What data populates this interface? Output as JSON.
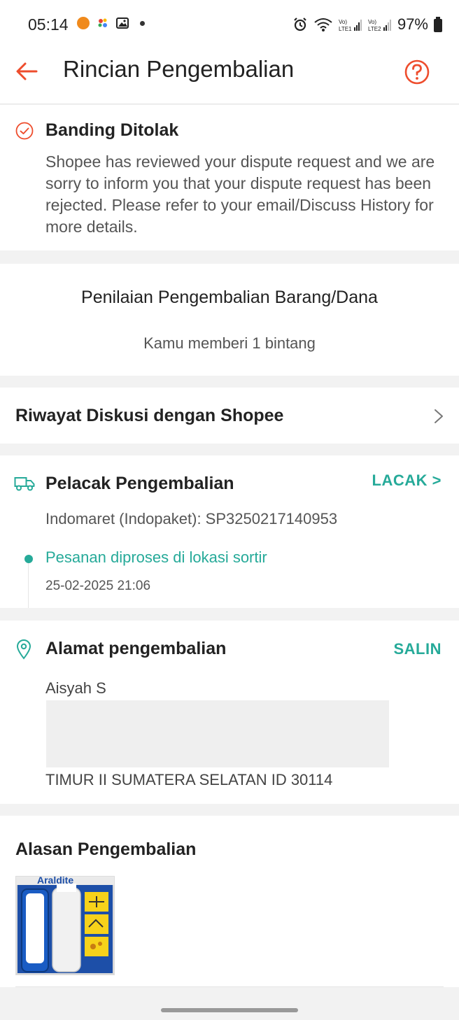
{
  "status_bar": {
    "time": "05:14",
    "battery": "97%"
  },
  "app_bar": {
    "title": "Rincian Pengembalian"
  },
  "status": {
    "title": "Banding Ditolak",
    "description": "Shopee has reviewed your dispute request and we are sorry to inform you that your dispute request has been rejected. Please refer to your email/Discuss History for more details."
  },
  "rating": {
    "title": "Penilaian Pengembalian Barang/Dana",
    "summary": "Kamu memberi 1 bintang",
    "stars": 1
  },
  "discussion": {
    "label": "Riwayat Diskusi dengan Shopee"
  },
  "tracking": {
    "title": "Pelacak Pengembalian",
    "link": "LACAK >",
    "courier": "Indomaret (Indopaket): SP3250217140953",
    "latest_status": "Pesanan diproses di lokasi sortir",
    "latest_time": "25-02-2025 21:06"
  },
  "address": {
    "title": "Alamat pengembalian",
    "copy": "SALIN",
    "name": "Aisyah S",
    "last_line": "TIMUR II SUMATERA SELATAN ID 30114"
  },
  "reason": {
    "title": "Alasan Pengembalian"
  },
  "colors": {
    "accent": "#ee4d2d",
    "teal": "#26aa99"
  },
  "icons": {
    "back": "arrow-left-icon",
    "help": "question-circle-icon",
    "status": "check-circle-icon",
    "chevron": "chevron-right-icon",
    "truck": "truck-icon",
    "pin": "location-pin-icon"
  }
}
